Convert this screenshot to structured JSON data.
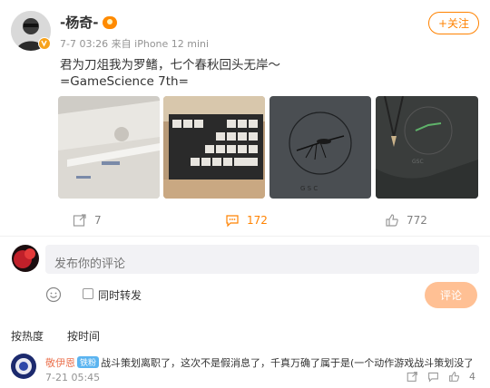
{
  "post": {
    "author_name": "-杨奇-",
    "meta": "7-7 03:26  来自 iPhone 12 mini",
    "follow_label": "+关注",
    "text_line1": "君为刀俎我为罗鳍，七个春秋回头无岸～",
    "text_line2": "=GameScience 7th=",
    "repost_count": "7",
    "comment_count": "172",
    "like_count": "772"
  },
  "composer": {
    "placeholder": "发布你的评论",
    "repost_label": "同时转发",
    "submit_label": "评论"
  },
  "sort_tabs": {
    "hot": "按热度",
    "time": "按时间"
  },
  "comments": [
    {
      "name": "敬伊恩",
      "badge": "铁粉",
      "text": "战斗策划离职了，这次不是假消息了，千真万确了属于是(一个动作游戏战斗策划没了",
      "date": "7-21 05:45",
      "likes": "4"
    }
  ],
  "icons": {
    "repost": "repost-icon",
    "comment": "comment-icon",
    "like": "like-icon",
    "emoji": "emoji-icon",
    "verified": "verified-badge-icon"
  },
  "colors": {
    "accent": "#ff8200",
    "submit_disabled": "#ffc094",
    "verified": "#f7a21a"
  }
}
